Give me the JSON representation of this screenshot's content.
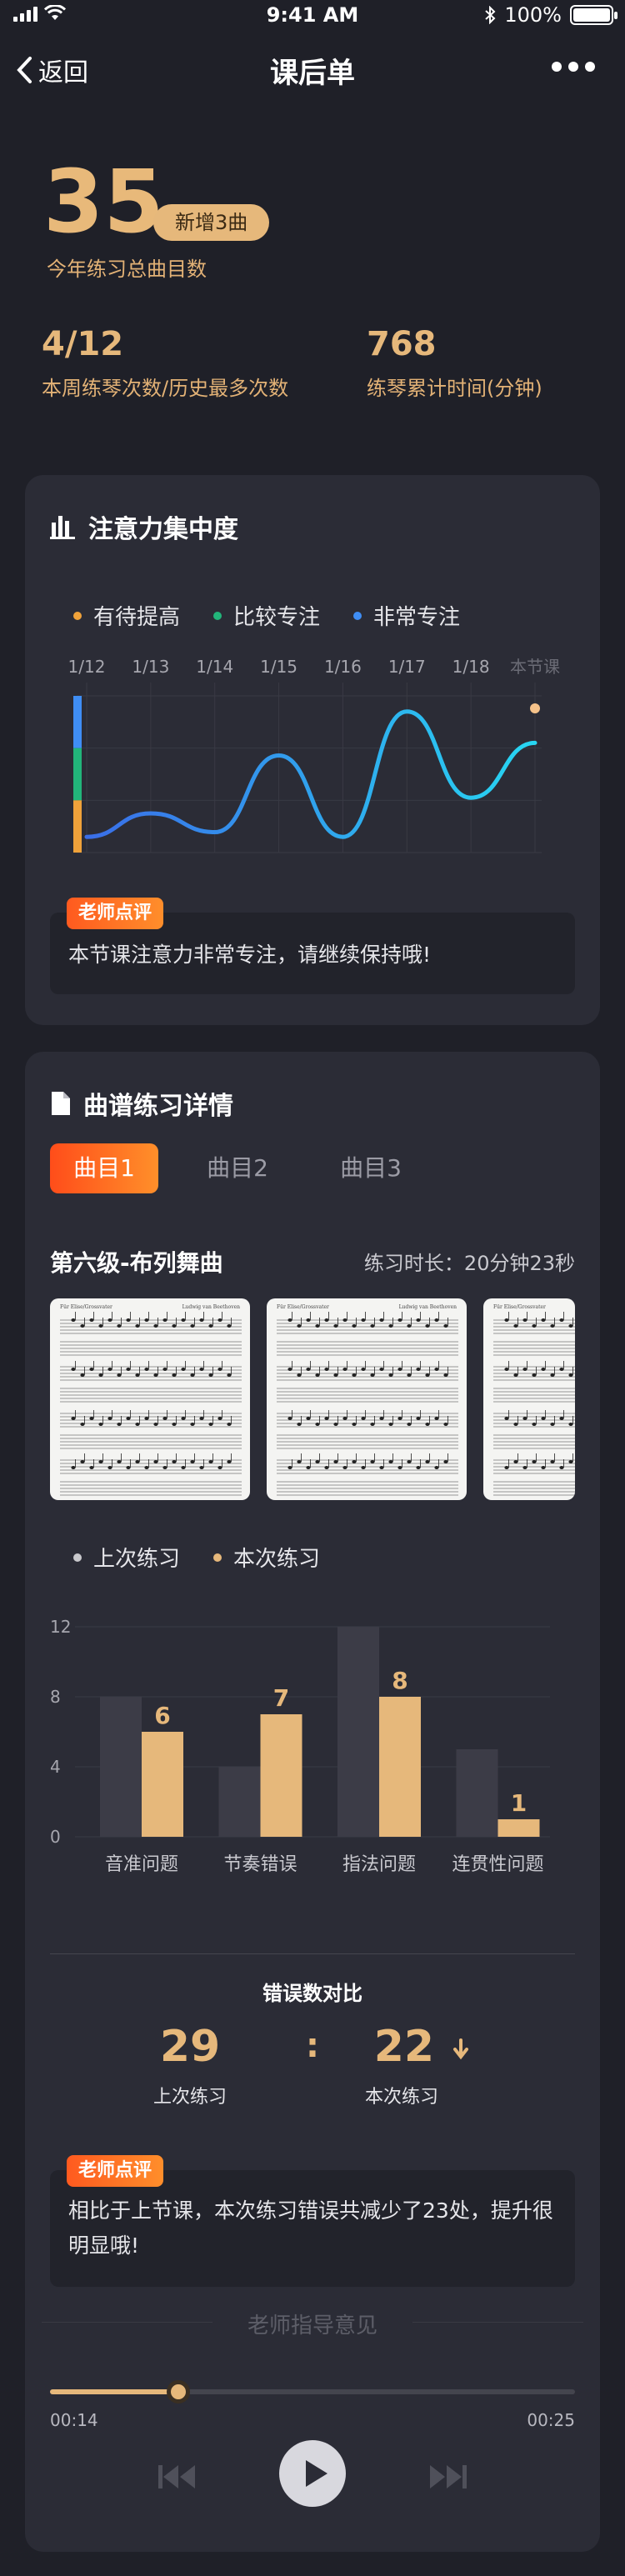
{
  "status": {
    "time": "9:41 AM",
    "battery": "100%"
  },
  "nav": {
    "back_label": "返回",
    "title": "课后单"
  },
  "summary": {
    "total_count": "35",
    "new_badge": "新增3曲",
    "total_label": "今年练习总曲目数",
    "week_value": "4/12",
    "week_label": "本周练琴次数/历史最多次数",
    "minutes_value": "768",
    "minutes_label": "练琴累计时间(分钟)"
  },
  "attention": {
    "title": "注意力集中度",
    "legend": [
      {
        "label": "有待提高",
        "color": "#f0a23a"
      },
      {
        "label": "比较专注",
        "color": "#22b57a"
      },
      {
        "label": "非常专注",
        "color": "#3f8ef5"
      }
    ],
    "chart_data": {
      "type": "line",
      "categories": [
        "1/12",
        "1/13",
        "1/14",
        "1/15",
        "1/16",
        "1/17",
        "1/18",
        "本节课"
      ],
      "values": [
        0.1,
        0.25,
        0.13,
        0.62,
        0.1,
        0.9,
        0.35,
        0.7
      ],
      "ylim": [
        0,
        1
      ],
      "bands": [
        {
          "label": "有待提高",
          "color": "#f0a23a"
        },
        {
          "label": "比较专注",
          "color": "#22b57a"
        },
        {
          "label": "非常专注",
          "color": "#3f8ef5"
        }
      ]
    },
    "teacher_tag": "老师点评",
    "comment": "本节课注意力非常专注，请继续保持哦!"
  },
  "practice": {
    "title": "曲谱练习详情",
    "tabs": [
      "曲目1",
      "曲目2",
      "曲目3"
    ],
    "active_tab": 0,
    "piece_name": "第六级-布列舞曲",
    "duration_label": "练习时长：",
    "duration_value": "20分钟23秒",
    "sheet_heading": "Für Elise/Grossvater",
    "sheet_composer": "Ludwig van Beethoven",
    "legend": [
      {
        "label": "上次练习",
        "color": "#c8c8cc"
      },
      {
        "label": "本次练习",
        "color": "#e6b87b"
      }
    ],
    "chart_data": {
      "type": "bar",
      "categories": [
        "音准问题",
        "节奏错误",
        "指法问题",
        "连贯性问题"
      ],
      "series": [
        {
          "name": "上次练习",
          "values": [
            8,
            4,
            12,
            5
          ],
          "color": "#3c3c47"
        },
        {
          "name": "本次练习",
          "values": [
            6,
            7,
            8,
            1
          ],
          "color": "#e6b87b"
        }
      ],
      "ylim": [
        0,
        12
      ],
      "yticks": [
        0,
        4,
        8,
        12
      ],
      "data_labels": [
        "6",
        "7",
        "8",
        "1"
      ]
    },
    "errors_title": "错误数对比",
    "last_errors": "29",
    "last_label": "上次练习",
    "separator": ":",
    "this_errors": "22",
    "this_label": "本次练习",
    "teacher_tag": "老师点评",
    "comment": "相比于上节课，本次练习错误共减少了23处，提升很明显哦!",
    "guidance_title": "老师指导意见",
    "audio": {
      "current": "00:14",
      "total": "00:25",
      "progress": 0.245
    }
  }
}
